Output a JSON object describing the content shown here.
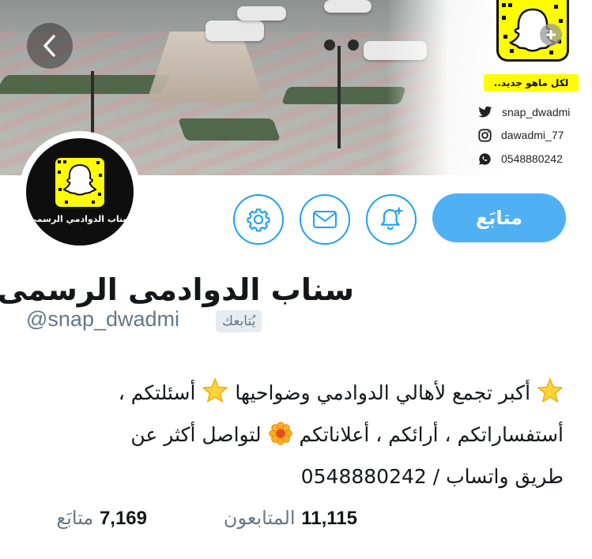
{
  "header": {
    "tagline": "لكل ماهو جديد..",
    "contacts": [
      {
        "icon": "twitter-icon",
        "text": "snap_dwadmi"
      },
      {
        "icon": "instagram-icon",
        "text": "dawadmi_77"
      },
      {
        "icon": "whatsapp-icon",
        "text": "0548880242"
      }
    ]
  },
  "avatar": {
    "caption": "سناب الدوادمي الرسمي"
  },
  "actions": {
    "follow_label": "متابَع",
    "settings_icon": "gear-icon",
    "message_icon": "envelope-icon",
    "notify_icon": "bell-plus-icon"
  },
  "profile": {
    "display_name": "سناب الدوادمى الرسمى",
    "handle": "@snap_dwadmi",
    "follows_you": "يُتابعك",
    "bio_lines": [
      "أكبر تجمع لأهالي الدوادمي وضواحيها",
      "أسئلتكم ،",
      "أستفساراتكم ، أرائكم ، أعلاناتكم",
      "لتواصل أكثر عن",
      "طريق واتساب / 0548880242"
    ]
  },
  "stats": {
    "following_count": "7,169",
    "following_label": "متابَع",
    "followers_count": "11,115",
    "followers_label": "المتابعون"
  },
  "colors": {
    "accent": "#1da1f2",
    "follow_button": "#50b0f4",
    "snap_yellow": "#fffc00",
    "muted_text": "#657786"
  }
}
